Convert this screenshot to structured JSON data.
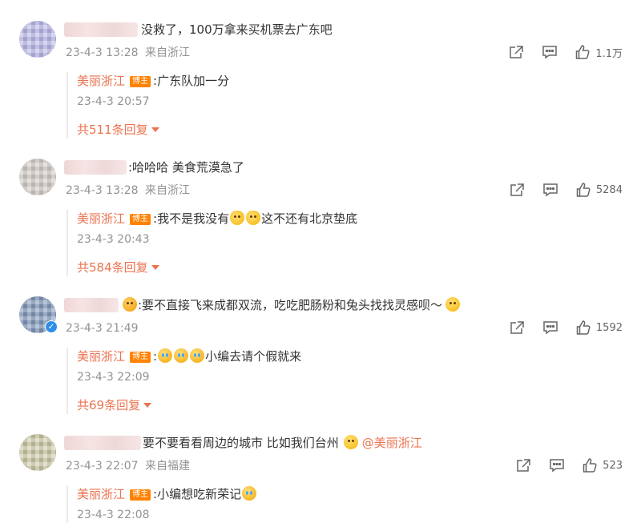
{
  "comments": [
    {
      "text": "没救了，100万拿来买机票去广东吧",
      "date": "23-4-3 13:28",
      "location": "来自浙江",
      "likes": "1.1万",
      "reply": {
        "author": "美丽浙江",
        "tag": "博主",
        "text": ":广东队加一分",
        "date": "23-4-3 20:57"
      },
      "more": "共511条回复"
    },
    {
      "text": ":哈哈哈 美食荒漠急了",
      "date": "23-4-3 13:28",
      "location": "来自浙江",
      "likes": "5284",
      "reply": {
        "author": "美丽浙江",
        "tag": "博主",
        "text_a": ":我不是我没有",
        "text_b": "这不还有北京垫底",
        "date": "23-4-3 20:43"
      },
      "more": "共584条回复"
    },
    {
      "text": ":要不直接飞来成都双流，吃吃肥肠粉和兔头找找灵感呗～",
      "date": "23-4-3 21:49",
      "location": "",
      "likes": "1592",
      "verified_icon": "verified-v-icon",
      "reply": {
        "author": "美丽浙江",
        "tag": "博主",
        "text_a": ":",
        "text_b": "小编去请个假就来",
        "date": "23-4-3 22:09"
      },
      "more": "共69条回复"
    },
    {
      "text": "要不要看看周边的城市 比如我们台州",
      "mention": "@美丽浙江",
      "date": "23-4-3 22:07",
      "location": "来自福建",
      "likes": "523",
      "reply": {
        "author": "美丽浙江",
        "tag": "博主",
        "text": ":小编想吃新荣记",
        "date": "23-4-3 22:08"
      }
    }
  ],
  "icons": {
    "share": "share-icon",
    "comment": "comment-icon",
    "like": "thumbs-up-icon",
    "more_caret": "caret-down-icon",
    "emoji": "emoji-icon"
  },
  "colors": {
    "accent": "#eb7350",
    "tag_bg": "#ff8200",
    "meta": "#939393",
    "verified": "#2f8fe6"
  }
}
